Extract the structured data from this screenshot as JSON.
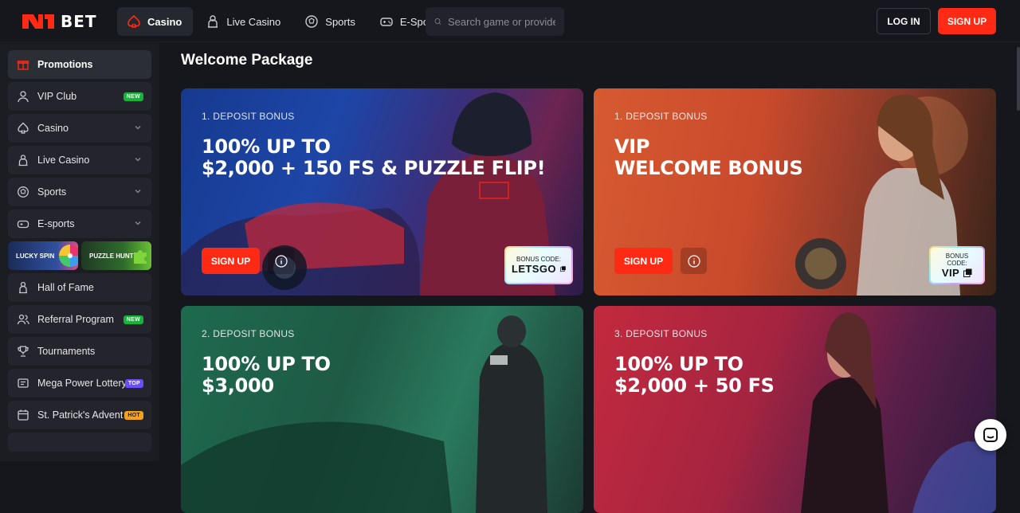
{
  "brand": {
    "name": "BET",
    "accent": "#ff2a14"
  },
  "nav": {
    "items": [
      {
        "label": "Casino",
        "icon": "spade-icon",
        "active": true
      },
      {
        "label": "Live Casino",
        "icon": "dealer-icon"
      },
      {
        "label": "Sports",
        "icon": "ball-icon"
      },
      {
        "label": "E-Sports",
        "icon": "gamepad-icon"
      }
    ],
    "search_placeholder": "Search game or provider",
    "login_label": "LOG IN",
    "signup_label": "SIGN UP"
  },
  "sidebar": {
    "items": [
      {
        "label": "Promotions",
        "icon": "gift-icon",
        "active": true
      },
      {
        "label": "VIP Club",
        "icon": "user-icon",
        "badge": "NEW"
      },
      {
        "label": "Casino",
        "icon": "spade-icon",
        "chevron": true
      },
      {
        "label": "Live Casino",
        "icon": "dealer-icon",
        "chevron": true
      },
      {
        "label": "Sports",
        "icon": "ball-icon",
        "chevron": true
      },
      {
        "label": "E-sports",
        "icon": "gamepad-icon",
        "chevron": true
      }
    ],
    "tiles": [
      {
        "label": "LUCKY SPIN"
      },
      {
        "label": "PUZZLE HUNT"
      }
    ],
    "items2": [
      {
        "label": "Hall of Fame",
        "icon": "trophy-person-icon"
      },
      {
        "label": "Referral Program",
        "icon": "users-icon",
        "badge": "NEW"
      },
      {
        "label": "Tournaments",
        "icon": "trophy-icon"
      },
      {
        "label": "Mega Power Lottery",
        "icon": "ticket-icon",
        "badge": "TOP"
      },
      {
        "label": "St. Patrick's Advent",
        "icon": "calendar-icon",
        "badge": "HOT"
      }
    ]
  },
  "main": {
    "section_title": "Welcome Package",
    "cards": [
      {
        "kicker": "1. DEPOSIT BONUS",
        "line1": "100% UP TO",
        "line2": "$2,000 + 150 FS & PUZZLE FLIP!",
        "cta": "SIGN UP",
        "code_label": "BONUS CODE:",
        "code": "LETSGO"
      },
      {
        "kicker": "1. DEPOSIT BONUS",
        "line1": "VIP",
        "line2": "WELCOME BONUS",
        "cta": "SIGN UP",
        "code_label": "BONUS CODE:",
        "code": "VIP"
      },
      {
        "kicker": "2. DEPOSIT BONUS",
        "line1": "100% UP TO",
        "line2": "$3,000"
      },
      {
        "kicker": "3. DEPOSIT BONUS",
        "line1": "100% UP TO",
        "line2": "$2,000 + 50 FS"
      }
    ]
  }
}
